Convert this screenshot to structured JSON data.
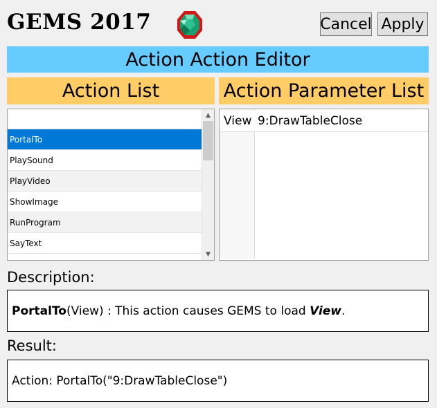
{
  "app": {
    "title": "GEMS 2017",
    "logo_icon": "green-gem-icon"
  },
  "toolbar": {
    "cancel_label": "Cancel",
    "apply_label": "Apply"
  },
  "editor": {
    "title": "Action Action Editor"
  },
  "action_list": {
    "header": "Action List",
    "filter_value": "",
    "items": [
      {
        "label": "PortalTo",
        "selected": true
      },
      {
        "label": "PlaySound",
        "selected": false
      },
      {
        "label": "PlayVideo",
        "selected": false
      },
      {
        "label": "ShowImage",
        "selected": false
      },
      {
        "label": "RunProgram",
        "selected": false
      },
      {
        "label": "SayText",
        "selected": false
      }
    ]
  },
  "parameter_list": {
    "header": "Action Parameter List",
    "rows": [
      {
        "name": "View",
        "value": "9:DrawTableClose"
      }
    ]
  },
  "description": {
    "label": "Description:",
    "function_name": "PortalTo",
    "signature": "(View) : This action causes GEMS to load ",
    "argument": "View",
    "trailing": "."
  },
  "result": {
    "label": "Result:",
    "text": "Action: PortalTo(\"9:DrawTableClose\")"
  },
  "colors": {
    "editor_title_bg": "#66ccff",
    "section_header_bg": "#ffcc66",
    "selection_bg": "#0078d7"
  }
}
